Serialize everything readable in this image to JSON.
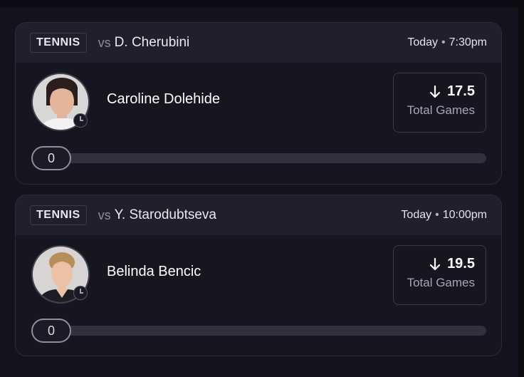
{
  "cards": [
    {
      "sport": "TENNIS",
      "vs": "vs",
      "opponent": "D. Cherubini",
      "day": "Today",
      "time": "7:30pm",
      "player": "Caroline Dolehide",
      "direction_icon": "arrow-down-icon",
      "line_value": "17.5",
      "stat": "Total Games",
      "slider_value": "0"
    },
    {
      "sport": "TENNIS",
      "vs": "vs",
      "opponent": "Y. Starodubtseva",
      "day": "Today",
      "time": "10:00pm",
      "player": "Belinda Bencic",
      "direction_icon": "arrow-down-icon",
      "line_value": "19.5",
      "stat": "Total Games",
      "slider_value": "0"
    }
  ],
  "colors": {
    "background": "#13131d",
    "card": "#161620",
    "header": "#20202c",
    "track": "#30303e"
  }
}
